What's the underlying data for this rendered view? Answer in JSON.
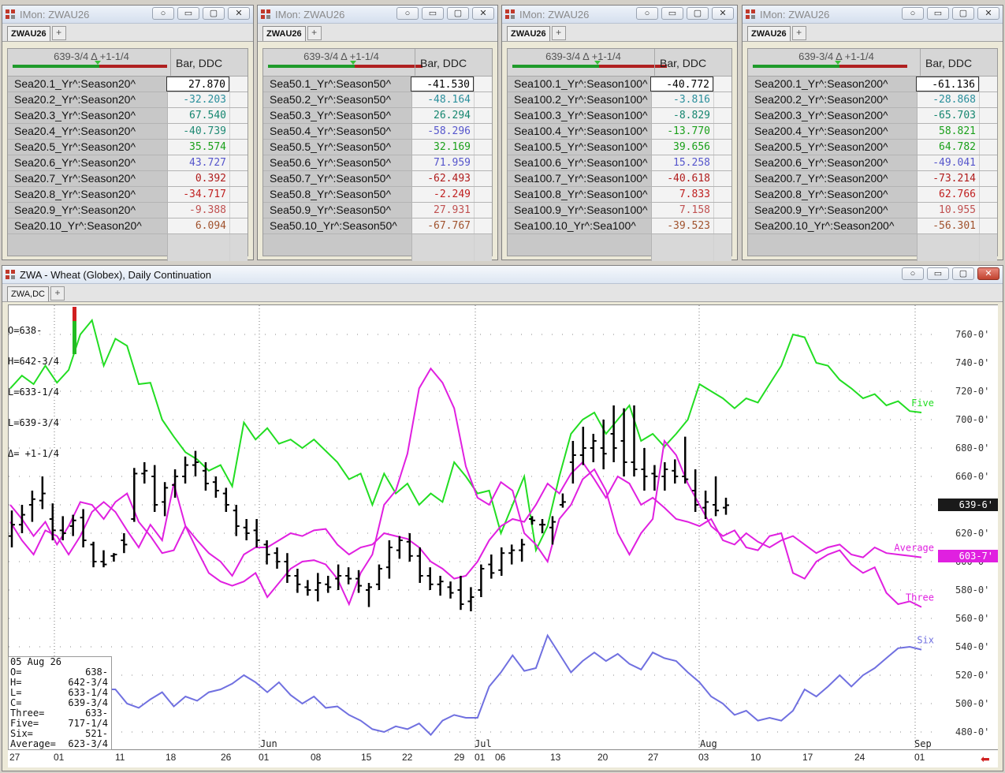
{
  "quote_windows": [
    {
      "title": "IMon: ZWAU26",
      "tab": "ZWAU26",
      "header_symbol": "639-3/4 Δ +1-1/4",
      "column": "Bar, DDC",
      "rows": [
        {
          "name": "Sea20.1_Yr^:Season20^",
          "value": "27.870",
          "color": "#000000"
        },
        {
          "name": "Sea20.2_Yr^:Season20^",
          "value": "-32.203",
          "color": "#2a8f9c"
        },
        {
          "name": "Sea20.3_Yr^:Season20^",
          "value": "67.540",
          "color": "#15866f"
        },
        {
          "name": "Sea20.4_Yr^:Season20^",
          "value": "-40.739",
          "color": "#1f8a74"
        },
        {
          "name": "Sea20.5_Yr^:Season20^",
          "value": "35.574",
          "color": "#1aa01a"
        },
        {
          "name": "Sea20.6_Yr^:Season20^",
          "value": "43.727",
          "color": "#5555cc"
        },
        {
          "name": "Sea20.7_Yr^:Season20^",
          "value": "0.392",
          "color": "#b01c1c"
        },
        {
          "name": "Sea20.8_Yr^:Season20^",
          "value": "-34.717",
          "color": "#c02020"
        },
        {
          "name": "Sea20.9_Yr^:Season20^",
          "value": "-9.388",
          "color": "#c05050"
        },
        {
          "name": "Sea20.10_Yr^:Season20^",
          "value": "6.094",
          "color": "#a0522d"
        }
      ]
    },
    {
      "title": "IMon: ZWAU26",
      "tab": "ZWAU26",
      "header_symbol": "639-3/4 Δ +1-1/4",
      "column": "Bar, DDC",
      "rows": [
        {
          "name": "Sea50.1_Yr^:Season50^",
          "value": "-41.530",
          "color": "#000000"
        },
        {
          "name": "Sea50.2_Yr^:Season50^",
          "value": "-48.164",
          "color": "#2a8f9c"
        },
        {
          "name": "Sea50.3_Yr^:Season50^",
          "value": "26.294",
          "color": "#15866f"
        },
        {
          "name": "Sea50.4_Yr^:Season50^",
          "value": "-58.296",
          "color": "#5555cc"
        },
        {
          "name": "Sea50.5_Yr^:Season50^",
          "value": "32.169",
          "color": "#1aa01a"
        },
        {
          "name": "Sea50.6_Yr^:Season50^",
          "value": "71.959",
          "color": "#5555cc"
        },
        {
          "name": "Sea50.7_Yr^:Season50^",
          "value": "-62.493",
          "color": "#b01c1c"
        },
        {
          "name": "Sea50.8_Yr^:Season50^",
          "value": "-2.249",
          "color": "#c02020"
        },
        {
          "name": "Sea50.9_Yr^:Season50^",
          "value": "27.931",
          "color": "#c05050"
        },
        {
          "name": "Sea50.10_Yr^:Season50^",
          "value": "-67.767",
          "color": "#a0522d"
        }
      ]
    },
    {
      "title": "IMon: ZWAU26",
      "tab": "ZWAU26",
      "header_symbol": "639-3/4 Δ +1-1/4",
      "column": "Bar, DDC",
      "rows": [
        {
          "name": "Sea100.1_Yr^:Season100^",
          "value": "-40.772",
          "color": "#000000"
        },
        {
          "name": "Sea100.2_Yr^:Season100^",
          "value": "-3.816",
          "color": "#2a8f9c"
        },
        {
          "name": "Sea100.3_Yr^:Season100^",
          "value": "-8.829",
          "color": "#15866f"
        },
        {
          "name": "Sea100.4_Yr^:Season100^",
          "value": "-13.770",
          "color": "#1aa01a"
        },
        {
          "name": "Sea100.5_Yr^:Season100^",
          "value": "39.656",
          "color": "#1aa01a"
        },
        {
          "name": "Sea100.6_Yr^:Season100^",
          "value": "15.258",
          "color": "#5555cc"
        },
        {
          "name": "Sea100.7_Yr^:Season100^",
          "value": "-40.618",
          "color": "#b01c1c"
        },
        {
          "name": "Sea100.8_Yr^:Season100^",
          "value": "7.833",
          "color": "#c02020"
        },
        {
          "name": "Sea100.9_Yr^:Season100^",
          "value": "7.158",
          "color": "#c05050"
        },
        {
          "name": "Sea100.10_Yr^:Sea100^",
          "value": "-39.523",
          "color": "#a0522d"
        }
      ]
    },
    {
      "title": "IMon: ZWAU26",
      "tab": "ZWAU26",
      "header_symbol": "639-3/4 Δ +1-1/4",
      "column": "Bar, DDC",
      "rows": [
        {
          "name": "Sea200.1_Yr^:Season200^",
          "value": "-61.136",
          "color": "#000000"
        },
        {
          "name": "Sea200.2_Yr^:Season200^",
          "value": "-28.868",
          "color": "#2a8f9c"
        },
        {
          "name": "Sea200.3_Yr^:Season200^",
          "value": "-65.703",
          "color": "#15866f"
        },
        {
          "name": "Sea200.4_Yr^:Season200^",
          "value": "58.821",
          "color": "#1aa01a"
        },
        {
          "name": "Sea200.5_Yr^:Season200^",
          "value": "64.782",
          "color": "#1aa01a"
        },
        {
          "name": "Sea200.6_Yr^:Season200^",
          "value": "-49.041",
          "color": "#5555cc"
        },
        {
          "name": "Sea200.7_Yr^:Season200^",
          "value": "-73.214",
          "color": "#b01c1c"
        },
        {
          "name": "Sea200.8_Yr^:Season200^",
          "value": "62.766",
          "color": "#c02020"
        },
        {
          "name": "Sea200.9_Yr^:Season200^",
          "value": "10.955",
          "color": "#c05050"
        },
        {
          "name": "Sea200.10_Yr^:Season200^",
          "value": "-56.301",
          "color": "#a0522d"
        }
      ]
    }
  ],
  "chart_window": {
    "title": "ZWA - Wheat (Globex), Daily Continuation",
    "tab": "ZWA,DC",
    "ohlc_header": {
      "open": "O=638-",
      "high": "H=642-3/4",
      "low": "L=633-1/4",
      "last": "L=639-3/4",
      "change": "Δ= +1-1/4"
    },
    "info_box": {
      "date": "05 Aug 26",
      "rows": [
        {
          "k": "O=",
          "v": "638-"
        },
        {
          "k": "H=",
          "v": "642-3/4"
        },
        {
          "k": "L=",
          "v": "633-1/4"
        },
        {
          "k": "C=",
          "v": "639-3/4"
        },
        {
          "k": "Three=",
          "v": "633-"
        },
        {
          "k": "Five=",
          "v": "717-1/4"
        },
        {
          "k": "Six=",
          "v": "521-"
        },
        {
          "k": "Average=",
          "v": "623-3/4"
        }
      ]
    },
    "last_price_tag": "639-6'",
    "average_tag": "603-7'"
  },
  "chart_data": {
    "type": "line",
    "ylim": [
      465,
      775
    ],
    "y_ticks": [
      "760-0'",
      "740-0'",
      "720-0'",
      "700-0'",
      "680-0'",
      "660-0'",
      "640-0'",
      "620-0'",
      "600-0'",
      "580-0'",
      "560-0'",
      "540-0'",
      "520-0'",
      "500-0'",
      "480-0'"
    ],
    "x_tick_labels": [
      "27",
      "01",
      "11",
      "18",
      "26",
      "01",
      "08",
      "15",
      "22",
      "29",
      "01",
      "06",
      "13",
      "20",
      "27",
      "03",
      "10",
      "17",
      "24",
      "01"
    ],
    "month_labels": [
      "Jun",
      "Jul",
      "Aug",
      "Sep"
    ],
    "series": [
      {
        "name": "Five",
        "color": "#22dd22",
        "values": [
          722,
          731,
          725,
          738,
          726,
          735,
          760,
          770,
          738,
          757,
          752,
          725,
          726,
          700,
          688,
          677,
          672,
          664,
          668,
          653,
          698,
          686,
          694,
          683,
          686,
          680,
          686,
          678,
          670,
          658,
          662,
          640,
          662,
          648,
          655,
          640,
          648,
          642,
          670,
          660,
          648,
          650,
          620,
          640,
          660,
          608,
          625,
          660,
          690,
          700,
          705,
          690,
          700,
          710,
          685,
          690,
          681,
          690,
          700,
          725,
          720,
          715,
          708,
          715,
          712,
          725,
          738,
          760,
          758,
          740,
          738,
          728,
          722,
          715,
          718,
          710,
          713,
          706,
          705
        ]
      },
      {
        "name": "Three",
        "color": "#e020e0",
        "values": [
          628,
          615,
          605,
          622,
          618,
          605,
          618,
          635,
          642,
          635,
          622,
          610,
          626,
          615,
          655,
          625,
          608,
          592,
          586,
          583,
          586,
          592,
          575,
          585,
          595,
          600,
          601,
          598,
          588,
          570,
          592,
          605,
          640,
          650,
          676,
          722,
          736,
          726,
          708,
          667,
          645,
          640,
          656,
          650,
          620,
          612,
          600,
          630,
          640,
          658,
          665,
          650,
          620,
          605,
          620,
          630,
          685,
          675,
          655,
          640,
          625,
          618,
          622,
          610,
          608,
          618,
          620,
          592,
          588,
          600,
          605,
          608,
          598,
          592,
          596,
          578,
          570,
          572,
          568
        ]
      },
      {
        "name": "Average",
        "color": "#e020e0",
        "values": [
          640,
          630,
          618,
          628,
          612,
          625,
          642,
          640,
          630,
          642,
          648,
          628,
          618,
          606,
          608,
          625,
          615,
          606,
          600,
          590,
          605,
          610,
          610,
          615,
          620,
          618,
          622,
          623,
          612,
          605,
          610,
          612,
          620,
          618,
          616,
          610,
          600,
          595,
          588,
          590,
          600,
          615,
          625,
          630,
          628,
          640,
          655,
          648,
          662,
          670,
          658,
          645,
          660,
          655,
          640,
          645,
          638,
          630,
          628,
          625,
          630,
          615,
          612,
          620,
          614,
          610,
          615,
          618,
          612,
          606,
          610,
          612,
          605,
          603,
          610,
          606,
          605,
          604,
          603
        ]
      },
      {
        "name": "Six",
        "color": "#7070e0",
        "values": [
          510,
          515,
          520,
          518,
          523,
          524,
          522,
          515,
          510,
          510,
          500,
          497,
          503,
          508,
          498,
          505,
          502,
          508,
          510,
          514,
          520,
          515,
          508,
          515,
          506,
          500,
          505,
          497,
          498,
          492,
          488,
          482,
          480,
          484,
          482,
          486,
          478,
          488,
          492,
          490,
          490,
          512,
          522,
          534,
          523,
          525,
          548,
          535,
          522,
          530,
          536,
          530,
          535,
          528,
          524,
          536,
          532,
          530,
          522,
          515,
          505,
          500,
          492,
          495,
          488,
          490,
          488,
          495,
          510,
          505,
          512,
          520,
          512,
          520,
          525,
          532,
          539,
          540,
          538
        ]
      }
    ],
    "bars": [
      {
        "o": 618,
        "h": 636,
        "l": 610,
        "c": 626
      },
      {
        "o": 626,
        "h": 640,
        "l": 620,
        "c": 633
      },
      {
        "o": 640,
        "h": 650,
        "l": 628,
        "c": 644
      },
      {
        "o": 643,
        "h": 660,
        "l": 637,
        "c": 648
      },
      {
        "o": 630,
        "h": 641,
        "l": 615,
        "c": 622
      },
      {
        "o": 622,
        "h": 632,
        "l": 615,
        "c": 620
      },
      {
        "o": 625,
        "h": 633,
        "l": 618,
        "c": 629
      },
      {
        "o": 631,
        "h": 637,
        "l": 610,
        "c": 615
      },
      {
        "o": 612,
        "h": 614,
        "l": 596,
        "c": 600
      },
      {
        "o": 600,
        "h": 608,
        "l": 596,
        "c": 598
      },
      {
        "o": 604,
        "h": 606,
        "l": 600,
        "c": 605
      },
      {
        "o": 615,
        "h": 620,
        "l": 606,
        "c": 612
      },
      {
        "o": 630,
        "h": 666,
        "l": 628,
        "c": 662
      },
      {
        "o": 662,
        "h": 670,
        "l": 655,
        "c": 664
      },
      {
        "o": 660,
        "h": 668,
        "l": 635,
        "c": 640
      },
      {
        "o": 642,
        "h": 656,
        "l": 632,
        "c": 652
      },
      {
        "o": 654,
        "h": 665,
        "l": 645,
        "c": 660
      },
      {
        "o": 660,
        "h": 674,
        "l": 655,
        "c": 668
      },
      {
        "o": 668,
        "h": 678,
        "l": 660,
        "c": 670
      },
      {
        "o": 664,
        "h": 670,
        "l": 650,
        "c": 655
      },
      {
        "o": 656,
        "h": 660,
        "l": 645,
        "c": 650
      },
      {
        "o": 648,
        "h": 652,
        "l": 635,
        "c": 640
      },
      {
        "o": 636,
        "h": 640,
        "l": 618,
        "c": 625
      },
      {
        "o": 624,
        "h": 630,
        "l": 615,
        "c": 620
      },
      {
        "o": 622,
        "h": 630,
        "l": 610,
        "c": 615
      },
      {
        "o": 612,
        "h": 615,
        "l": 598,
        "c": 605
      },
      {
        "o": 606,
        "h": 610,
        "l": 595,
        "c": 600
      },
      {
        "o": 600,
        "h": 606,
        "l": 585,
        "c": 590
      },
      {
        "o": 590,
        "h": 595,
        "l": 578,
        "c": 584
      },
      {
        "o": 582,
        "h": 587,
        "l": 576,
        "c": 580
      },
      {
        "o": 580,
        "h": 592,
        "l": 572,
        "c": 585
      },
      {
        "o": 584,
        "h": 590,
        "l": 578,
        "c": 582
      },
      {
        "o": 588,
        "h": 598,
        "l": 580,
        "c": 590
      },
      {
        "o": 590,
        "h": 596,
        "l": 584,
        "c": 588
      },
      {
        "o": 588,
        "h": 594,
        "l": 578,
        "c": 583
      },
      {
        "o": 580,
        "h": 585,
        "l": 568,
        "c": 582
      },
      {
        "o": 584,
        "h": 598,
        "l": 580,
        "c": 595
      },
      {
        "o": 596,
        "h": 615,
        "l": 588,
        "c": 610
      },
      {
        "o": 608,
        "h": 618,
        "l": 602,
        "c": 615
      },
      {
        "o": 614,
        "h": 620,
        "l": 600,
        "c": 604
      },
      {
        "o": 604,
        "h": 610,
        "l": 585,
        "c": 590
      },
      {
        "o": 590,
        "h": 596,
        "l": 580,
        "c": 584
      },
      {
        "o": 584,
        "h": 590,
        "l": 576,
        "c": 586
      },
      {
        "o": 582,
        "h": 586,
        "l": 574,
        "c": 578
      },
      {
        "o": 580,
        "h": 590,
        "l": 566,
        "c": 570
      },
      {
        "o": 572,
        "h": 582,
        "l": 565,
        "c": 575
      },
      {
        "o": 580,
        "h": 598,
        "l": 575,
        "c": 595
      },
      {
        "o": 598,
        "h": 605,
        "l": 588,
        "c": 592
      },
      {
        "o": 594,
        "h": 610,
        "l": 590,
        "c": 606
      },
      {
        "o": 606,
        "h": 612,
        "l": 598,
        "c": 608
      },
      {
        "o": 608,
        "h": 616,
        "l": 600,
        "c": 612
      },
      {
        "o": 630,
        "h": 632,
        "l": 626,
        "c": 629
      },
      {
        "o": 626,
        "h": 630,
        "l": 620,
        "c": 626
      },
      {
        "o": 624,
        "h": 632,
        "l": 612,
        "c": 628
      },
      {
        "o": 640,
        "h": 648,
        "l": 638,
        "c": 642
      },
      {
        "o": 670,
        "h": 685,
        "l": 655,
        "c": 675
      },
      {
        "o": 675,
        "h": 695,
        "l": 668,
        "c": 680
      },
      {
        "o": 680,
        "h": 690,
        "l": 670,
        "c": 685
      },
      {
        "o": 680,
        "h": 700,
        "l": 665,
        "c": 676
      },
      {
        "o": 690,
        "h": 710,
        "l": 670,
        "c": 680
      },
      {
        "o": 685,
        "h": 708,
        "l": 660,
        "c": 670
      },
      {
        "o": 670,
        "h": 710,
        "l": 660,
        "c": 665
      },
      {
        "o": 665,
        "h": 680,
        "l": 650,
        "c": 660
      },
      {
        "o": 662,
        "h": 668,
        "l": 650,
        "c": 660
      },
      {
        "o": 660,
        "h": 670,
        "l": 650,
        "c": 665
      },
      {
        "o": 664,
        "h": 672,
        "l": 655,
        "c": 660
      },
      {
        "o": 660,
        "h": 688,
        "l": 655,
        "c": 658
      },
      {
        "o": 650,
        "h": 665,
        "l": 635,
        "c": 640
      },
      {
        "o": 638,
        "h": 650,
        "l": 630,
        "c": 642
      },
      {
        "o": 640,
        "h": 660,
        "l": 632,
        "c": 636
      },
      {
        "o": 638,
        "h": 645,
        "l": 633,
        "c": 639.75
      }
    ]
  }
}
